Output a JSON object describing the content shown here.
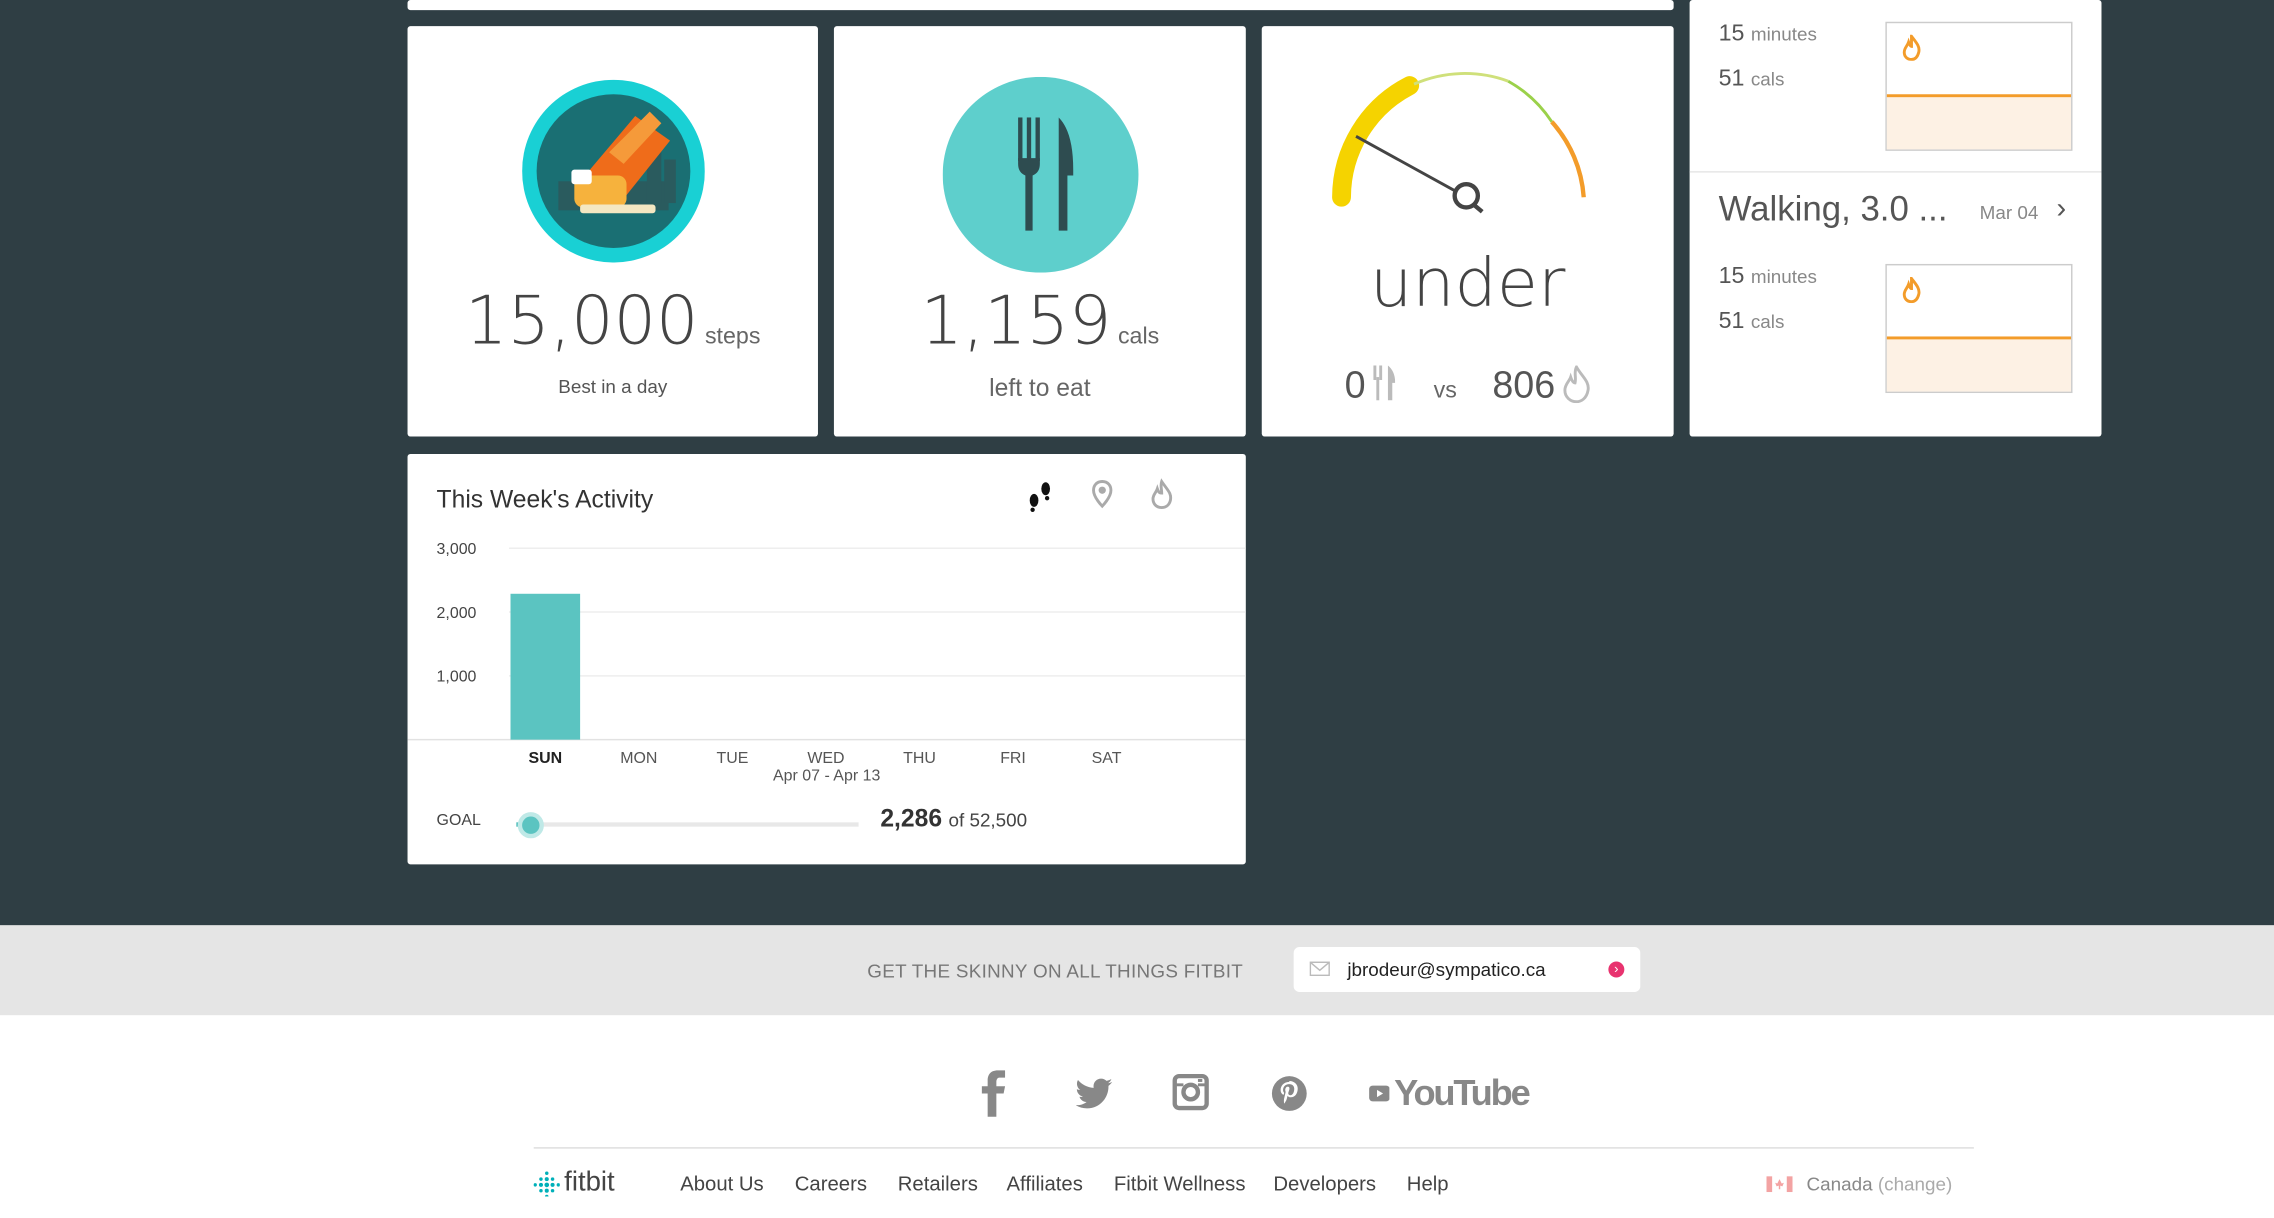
{
  "tiles": {
    "steps": {
      "value": "15,000",
      "unit": "steps",
      "caption": "Best in a day"
    },
    "food": {
      "value": "1,159",
      "unit": "cals",
      "caption": "left to eat"
    },
    "balance": {
      "status": "under",
      "in_value": "0",
      "vs": "vs",
      "out_value": "806"
    }
  },
  "exercises": [
    {
      "minutes": "15",
      "minutes_unit": "minutes",
      "cals": "51",
      "cals_unit": "cals"
    },
    {
      "title": "Walking, 3.0 ...",
      "date": "Mar 04",
      "minutes": "15",
      "minutes_unit": "minutes",
      "cals": "51",
      "cals_unit": "cals"
    }
  ],
  "weekly": {
    "title": "This Week's Activity",
    "date_range": "Apr 07 - Apr 13",
    "goal_label": "GOAL",
    "total": "2,286",
    "of_text": "of 52,500",
    "goal_progress": 0.0435,
    "tabs": [
      "steps-icon",
      "location-icon",
      "flame-icon"
    ]
  },
  "chart_data": {
    "type": "bar",
    "categories": [
      "SUN",
      "MON",
      "TUE",
      "WED",
      "THU",
      "FRI",
      "SAT"
    ],
    "values": [
      2286,
      0,
      0,
      0,
      0,
      0,
      0
    ],
    "ylim": [
      0,
      3000
    ],
    "yticks": [
      "1,000",
      "2,000",
      "3,000"
    ],
    "grid": true,
    "color": "#5bc4c1"
  },
  "newsletter": {
    "label": "GET THE SKINNY ON ALL THINGS FITBIT",
    "email": "jbrodeur@sympatico.ca"
  },
  "social": [
    "facebook-icon",
    "twitter-icon",
    "instagram-icon",
    "pinterest-icon",
    "youtube-logo"
  ],
  "youtube_text": "YouTube",
  "footer": {
    "brand": "fitbit",
    "links": [
      "About Us",
      "Careers",
      "Retailers",
      "Affiliates",
      "Fitbit Wellness",
      "Developers",
      "Help"
    ],
    "country": "Canada",
    "change": "change"
  },
  "colors": {
    "dashboard_bg": "#2f3e44",
    "teal": "#5bc4c1",
    "orange": "#f39c2a",
    "accent_pink": "#e8336f"
  }
}
